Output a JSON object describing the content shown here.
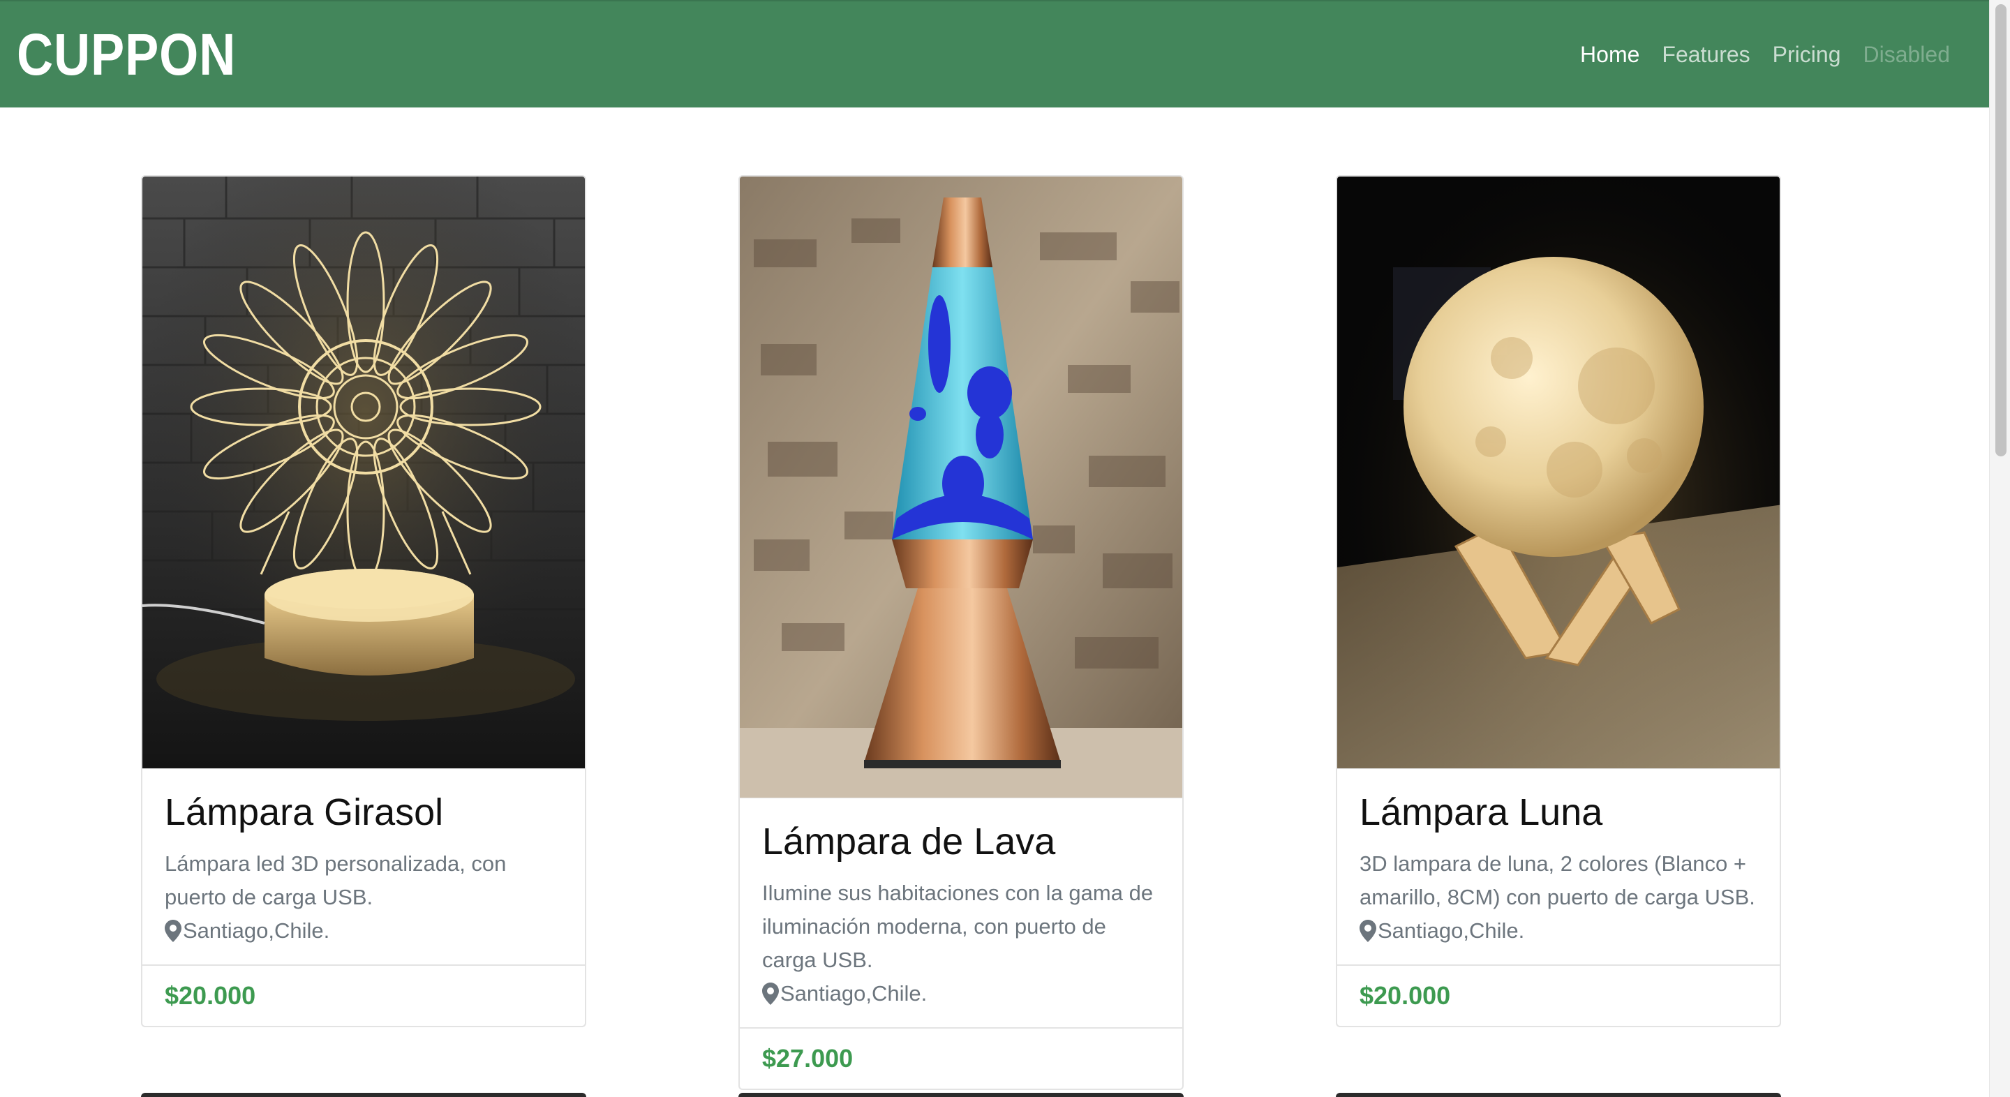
{
  "navbar": {
    "brand": "CUPPON",
    "links": [
      {
        "label": "Home",
        "state": "active"
      },
      {
        "label": "Features",
        "state": "normal"
      },
      {
        "label": "Pricing",
        "state": "normal"
      },
      {
        "label": "Disabled",
        "state": "disabled"
      }
    ]
  },
  "products": [
    {
      "title": "Lámpara Girasol",
      "description": "Lámpara led 3D personalizada, con puerto de carga USB.",
      "location": "Santiago,Chile.",
      "price": "$20.000"
    },
    {
      "title": "Lámpara de Lava",
      "description": "Ilumine sus habitaciones con la gama de iluminación moderna, con puerto de carga USB.",
      "location": "Santiago,Chile.",
      "price": "$27.000"
    },
    {
      "title": "Lámpara Luna",
      "description": "3D lampara de luna, 2 colores (Blanco + amarillo, 8CM) con puerto de carga USB.",
      "location": "Santiago,Chile.",
      "price": "$20.000"
    }
  ],
  "colors": {
    "navbar": "#43865b",
    "price": "#3d9a50",
    "muted_text": "#6c757d"
  }
}
